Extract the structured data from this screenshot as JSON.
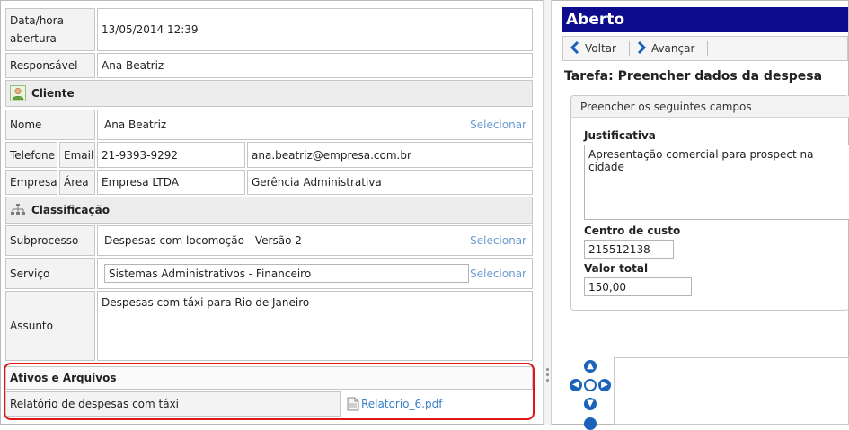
{
  "form": {
    "data_hora_label": "Data/hora abertura",
    "data_hora_value": "13/05/2014 12:39",
    "responsavel_label": "Responsável",
    "responsavel_value": "Ana Beatriz",
    "cliente_section": "Cliente",
    "nome_label": "Nome",
    "nome_value": "Ana Beatriz",
    "selecionar_label": "Selecionar",
    "telefone_label": "Telefone",
    "email_label": "Email",
    "telefone_value": "21-9393-9292",
    "email_value": "ana.beatriz@empresa.com.br",
    "empresa_label": "Empresa",
    "area_label": "Área",
    "empresa_value": "Empresa LTDA",
    "area_value": "Gerência Administrativa",
    "classificacao_section": "Classificação",
    "subprocesso_label": "Subprocesso",
    "subprocesso_value": "Despesas com locomoção - Versão 2",
    "servico_label": "Serviço",
    "servico_value": "Sistemas Administrativos - Financeiro",
    "assunto_label": "Assunto",
    "assunto_value": "Despesas com táxi para Rio de Janeiro",
    "ativos_section": "Ativos e Arquivos",
    "arquivo_label": "Relatório de despesas com táxi",
    "arquivo_file": "Relatorio_6.pdf"
  },
  "panel": {
    "status_title": "Aberto",
    "back_label": "Voltar",
    "forward_label": "Avançar",
    "task_title": "Tarefa: Preencher dados da despesa",
    "fields_header": "Preencher os seguintes campos",
    "justificativa_label": "Justificativa",
    "justificativa_value": "Apresentação comercial para prospect na cidade",
    "centro_custo_label": "Centro de custo",
    "centro_custo_value": "215512138",
    "valor_total_label": "Valor total",
    "valor_total_value": "150,00"
  },
  "colors": {
    "title_bar": "#0c0c8c",
    "link": "#6a9bd0",
    "highlight": "#e01616",
    "nav_arrows": "#1b63b8"
  },
  "icons": [
    "client-icon",
    "hierarchy-icon",
    "pdf-file-icon",
    "back-arrow-icon",
    "forward-arrow-icon",
    "nav-up-icon",
    "nav-down-icon",
    "nav-left-icon",
    "nav-right-icon",
    "nav-center-icon"
  ]
}
